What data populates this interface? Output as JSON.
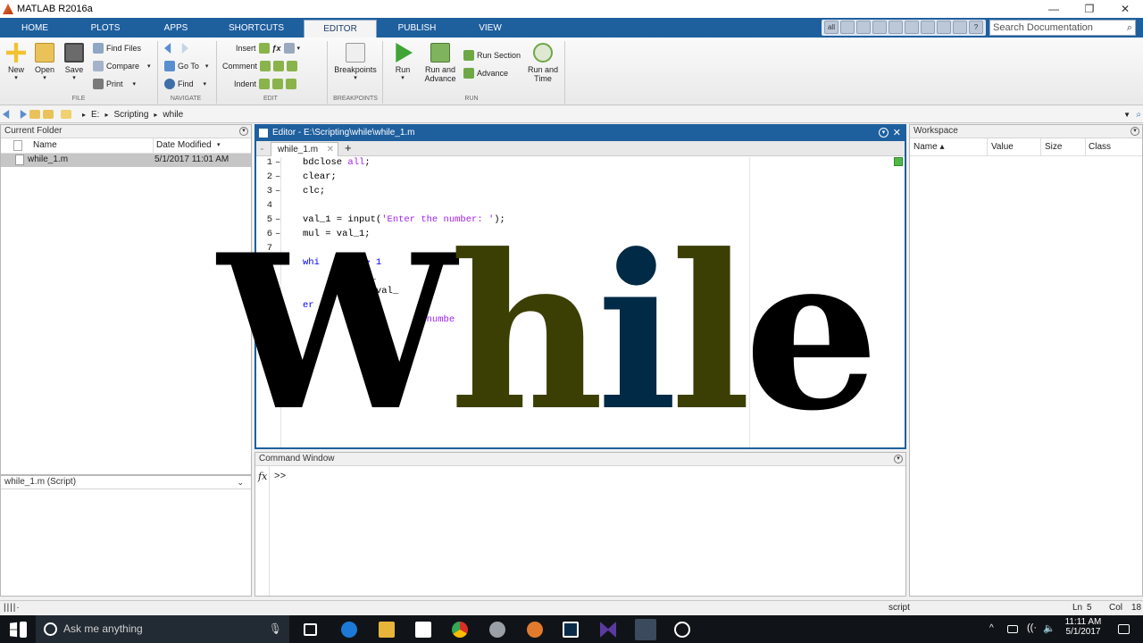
{
  "window": {
    "title": "MATLAB R2016a",
    "controls": [
      "—",
      "❐",
      "✕"
    ]
  },
  "tabs": [
    "HOME",
    "PLOTS",
    "APPS",
    "SHORTCUTS",
    "EDITOR",
    "PUBLISH",
    "VIEW"
  ],
  "active_tab": "EDITOR",
  "search": {
    "placeholder": "Search Documentation"
  },
  "quickbar_all": "all",
  "ribbon": {
    "file": {
      "new": "New",
      "open": "Open",
      "save": "Save",
      "find_files": "Find Files",
      "compare": "Compare",
      "print": "Print",
      "label": "FILE"
    },
    "navigate": {
      "go_to": "Go To",
      "find": "Find",
      "label": "NAVIGATE"
    },
    "edit": {
      "insert": "Insert",
      "comment": "Comment",
      "indent": "Indent",
      "label": "EDIT"
    },
    "breakpoints": {
      "button": "Breakpoints",
      "label": "BREAKPOINTS"
    },
    "run": {
      "run": "Run",
      "run_advance_1": "Run and",
      "run_advance_2": "Advance",
      "run_section": "Run Section",
      "advance": "Advance",
      "run_time_1": "Run and",
      "run_time_2": "Time",
      "label": "RUN"
    }
  },
  "address": {
    "drive": "E:",
    "folder1": "Scripting",
    "folder2": "while"
  },
  "current_folder": {
    "title": "Current Folder",
    "col_name": "Name",
    "col_date": "Date Modified",
    "files": [
      {
        "name": "while_1.m",
        "date": "5/1/2017 11:01 AM"
      }
    ],
    "details": "while_1.m  (Script)"
  },
  "editor": {
    "title": "Editor - E:\\Scripting\\while\\while_1.m",
    "tab": "while_1.m",
    "lines": [
      {
        "n": "1",
        "dash": "–",
        "parts": [
          {
            "t": "bdclose ",
            "c": ""
          },
          {
            "t": "all",
            "c": "kwp"
          },
          {
            "t": ";",
            "c": ""
          }
        ]
      },
      {
        "n": "2",
        "dash": "–",
        "parts": [
          {
            "t": "clear;",
            "c": ""
          }
        ]
      },
      {
        "n": "3",
        "dash": "–",
        "parts": [
          {
            "t": "clc;",
            "c": ""
          }
        ]
      },
      {
        "n": "4",
        "dash": "",
        "parts": []
      },
      {
        "n": "5",
        "dash": "–",
        "parts": [
          {
            "t": "val_1 = input(",
            "c": ""
          },
          {
            "t": "'Enter the number: '",
            "c": "str"
          },
          {
            "t": ");",
            "c": ""
          }
        ]
      },
      {
        "n": "6",
        "dash": "–",
        "parts": [
          {
            "t": "mul = val_1;",
            "c": ""
          }
        ]
      },
      {
        "n": "7",
        "dash": "",
        "parts": []
      },
      {
        "n": "",
        "dash": "",
        "parts": [
          {
            "t": "whi        > 1",
            "c": "kw"
          }
        ]
      },
      {
        "n": "",
        "dash": "",
        "parts": [
          {
            "t": "         val_",
            "c": ""
          }
        ]
      },
      {
        "n": "",
        "dash": "",
        "parts": [
          {
            "t": "            *val_",
            "c": ""
          }
        ]
      },
      {
        "n": "",
        "dash": "",
        "parts": [
          {
            "t": "er",
            "c": "kw"
          }
        ]
      },
      {
        "n": "",
        "dash": "",
        "parts": [
          {
            "t": "                    n numbe",
            "c": "str"
          }
        ]
      }
    ]
  },
  "overlay_word": [
    "W",
    "h",
    "i",
    "l",
    "e"
  ],
  "command_window": {
    "title": "Command Window",
    "fx": "fx",
    "prompt": ">>"
  },
  "workspace": {
    "title": "Workspace",
    "col_name": "Name ▴",
    "col_value": "Value",
    "col_size": "Size",
    "col_class": "Class"
  },
  "status": {
    "mode": "script",
    "ln_label": "Ln",
    "ln": "5",
    "col_label": "Col",
    "col": "18"
  },
  "taskbar": {
    "search": "Ask me anything",
    "time": "11:11 AM",
    "date": "5/1/2017"
  }
}
